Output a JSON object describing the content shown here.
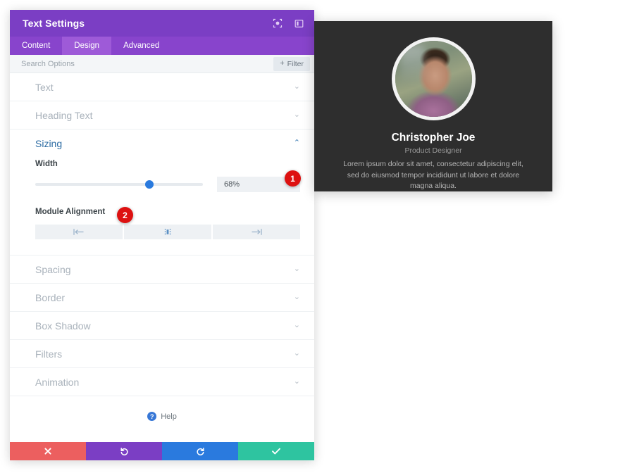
{
  "panel": {
    "title": "Text Settings",
    "header_icons": [
      {
        "name": "target-focus-icon"
      },
      {
        "name": "panel-layout-icon"
      }
    ],
    "tabs": [
      {
        "label": "Content",
        "active": false
      },
      {
        "label": "Design",
        "active": true
      },
      {
        "label": "Advanced",
        "active": false
      }
    ],
    "search": {
      "placeholder": "Search Options",
      "value": "",
      "filter_label": "Filter",
      "filter_plus": "+"
    },
    "sections": [
      {
        "label": "Text",
        "open": false,
        "chevron": "⌄"
      },
      {
        "label": "Heading Text",
        "open": false,
        "chevron": "⌄"
      },
      {
        "label": "Sizing",
        "open": true,
        "chevron": "⌃"
      },
      {
        "label": "Spacing",
        "open": false,
        "chevron": "⌄"
      },
      {
        "label": "Border",
        "open": false,
        "chevron": "⌄"
      },
      {
        "label": "Box Shadow",
        "open": false,
        "chevron": "⌄"
      },
      {
        "label": "Filters",
        "open": false,
        "chevron": "⌄"
      },
      {
        "label": "Animation",
        "open": false,
        "chevron": "⌄"
      }
    ],
    "sizing": {
      "width_label": "Width",
      "width_value": "68%",
      "width_percent": 68,
      "alignment_label": "Module Alignment",
      "alignment_options": [
        {
          "name": "align-left",
          "active": false
        },
        {
          "name": "align-center",
          "active": true
        },
        {
          "name": "align-right",
          "active": false
        }
      ]
    },
    "help": {
      "label": "Help",
      "icon_glyph": "?"
    },
    "footer_buttons": [
      {
        "name": "cancel-button",
        "icon": "close-icon",
        "color": "#ec5f5f"
      },
      {
        "name": "undo-button",
        "icon": "undo-icon",
        "color": "#7b3ec4"
      },
      {
        "name": "redo-button",
        "icon": "redo-icon",
        "color": "#2a7ade"
      },
      {
        "name": "save-button",
        "icon": "check-icon",
        "color": "#2ec4a0"
      }
    ]
  },
  "profile": {
    "name": "Christopher Joe",
    "role": "Product Designer",
    "description": "Lorem ipsum dolor sit amet, consectetur adipiscing elit, sed do eiusmod tempor incididunt ut labore et dolore magna aliqua.",
    "avatar_alt": "portrait-photo"
  },
  "annotations": [
    {
      "id": "1",
      "label": "1"
    },
    {
      "id": "2",
      "label": "2"
    }
  ],
  "colors": {
    "header_purple": "#7b3ec4",
    "tab_bar_purple": "#8844cc",
    "tab_active_purple": "#9e5ad8",
    "accent_blue": "#2a7ade",
    "badge_red": "#dd1111",
    "card_dark": "#2e2e2e",
    "save_green": "#2ec4a0",
    "cancel_red": "#ec5f5f"
  }
}
